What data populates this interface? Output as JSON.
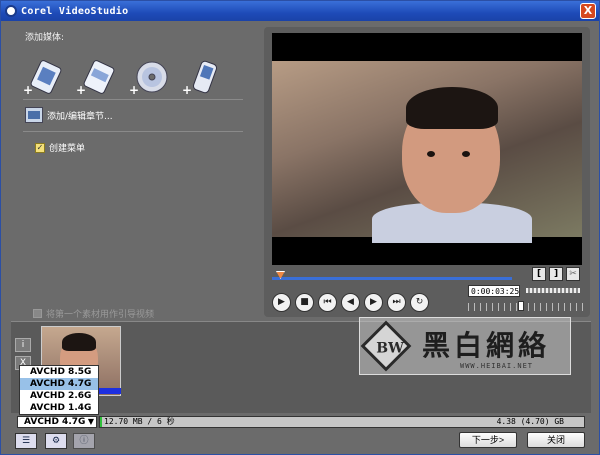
{
  "window": {
    "title": "Corel VideoStudio",
    "close_glyph": "X"
  },
  "left_panel": {
    "add_media_label": "添加媒体:",
    "media_buttons": [
      {
        "icon": "add-video-icon"
      },
      {
        "icon": "add-vsp-project-icon"
      },
      {
        "icon": "add-disc-icon"
      },
      {
        "icon": "add-device-icon"
      }
    ],
    "add_chapter_label": "添加/编辑章节...",
    "create_menu_label": "创建菜单",
    "create_menu_checked": true
  },
  "preview": {
    "timecode": "0:00:03:25",
    "trim_in": "[",
    "trim_out": "]",
    "controls": [
      "play",
      "stop",
      "home",
      "prev-frame",
      "next-frame",
      "end",
      "repeat"
    ]
  },
  "label_strip_text": "将第一个素材用作引导视频",
  "clip_side_buttons": [
    "i",
    "X"
  ],
  "watermark": {
    "mark": "BW",
    "text": "黑白網絡",
    "url": "WWW.HEIBAI.NET"
  },
  "disc_dropdown": {
    "options": [
      "AVCHD 8.5G",
      "AVCHD 4.7G",
      "AVCHD 2.6G",
      "AVCHD 1.4G"
    ],
    "selected": "AVCHD 4.7G"
  },
  "storage": {
    "used_text": "12.70 MB / 6 秒",
    "capacity_text": "4.38 (4.70) GB",
    "used_fraction": 0.003
  },
  "footer": {
    "next_label": "下一步>",
    "close_label": "关闭"
  },
  "colors": {
    "titlebar": "#1e4bb8",
    "usage_fill": "#2fbf3a",
    "thumb_bar": "#1d2fe0",
    "selected_option": "#98c1e8"
  }
}
